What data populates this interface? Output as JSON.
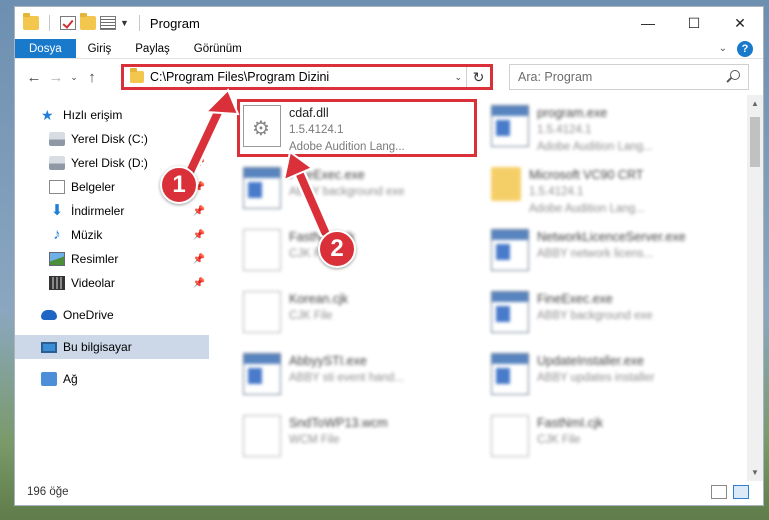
{
  "window": {
    "title": "Program",
    "controls": {
      "minimize": "—",
      "maximize": "☐",
      "close": "✕"
    }
  },
  "ribbon": {
    "tabs": [
      "Dosya",
      "Giriş",
      "Paylaş",
      "Görünüm"
    ],
    "help": "?"
  },
  "nav": {
    "address": "C:\\Program Files\\Program Dizini",
    "search_placeholder": "Ara: Program"
  },
  "sidebar": {
    "items": [
      {
        "label": "Hızlı erişim",
        "icon": "star-icon"
      },
      {
        "label": "Yerel Disk (C:)",
        "icon": "drive-icon"
      },
      {
        "label": "Yerel Disk (D:)",
        "icon": "drive-icon"
      },
      {
        "label": "Belgeler",
        "icon": "document-icon"
      },
      {
        "label": "İndirmeler",
        "icon": "download-icon"
      },
      {
        "label": "Müzik",
        "icon": "music-icon"
      },
      {
        "label": "Resimler",
        "icon": "pictures-icon"
      },
      {
        "label": "Videolar",
        "icon": "videos-icon"
      },
      {
        "label": "OneDrive",
        "icon": "cloud-icon"
      },
      {
        "label": "Bu bilgisayar",
        "icon": "computer-icon"
      },
      {
        "label": "Ağ",
        "icon": "network-icon"
      }
    ]
  },
  "files": [
    {
      "name": "cdaf.dll",
      "line2": "1.5.4124.1",
      "line3": "Adobe Audition Lang...",
      "icon": "dll-icon"
    },
    {
      "name": "program.exe",
      "line2": "1.5.4124.1",
      "line3": "Adobe Audition Lang...",
      "icon": "exe-icon"
    },
    {
      "name": "FineExec.exe",
      "line2": "ABBY background exe",
      "line3": "",
      "icon": "exe-icon"
    },
    {
      "name": "Microsoft VC90 CRT",
      "line2": "1.5.4124.1",
      "line3": "Adobe Audition Lang...",
      "icon": "folder-icon"
    },
    {
      "name": "FastNmI.cjk",
      "line2": "CJK File",
      "line3": "",
      "icon": "file-icon"
    },
    {
      "name": "NetworkLicenceServer.exe",
      "line2": "ABBY network licens...",
      "line3": "",
      "icon": "exe-icon"
    },
    {
      "name": "Korean.cjk",
      "line2": "CJK File",
      "line3": "",
      "icon": "file-icon"
    },
    {
      "name": "FineExec.exe",
      "line2": "ABBY background exe",
      "line3": "",
      "icon": "exe-icon"
    },
    {
      "name": "AbbyySTI.exe",
      "line2": "ABBY sti event hand...",
      "line3": "",
      "icon": "exe-icon"
    },
    {
      "name": "UpdateInstaller.exe",
      "line2": "ABBY updates installer",
      "line3": "",
      "icon": "exe-icon"
    },
    {
      "name": "SndToWP13.wcm",
      "line2": "WCM File",
      "line3": "",
      "icon": "file-icon"
    },
    {
      "name": "FastNmI.cjk",
      "line2": "CJK File",
      "line3": "",
      "icon": "file-icon"
    }
  ],
  "status": {
    "count": "196 öğe"
  },
  "annotations": {
    "step1": "1",
    "step2": "2"
  },
  "colors": {
    "accent": "#1979ca",
    "highlight": "#d9303a",
    "selected": "#ccd8e8"
  }
}
